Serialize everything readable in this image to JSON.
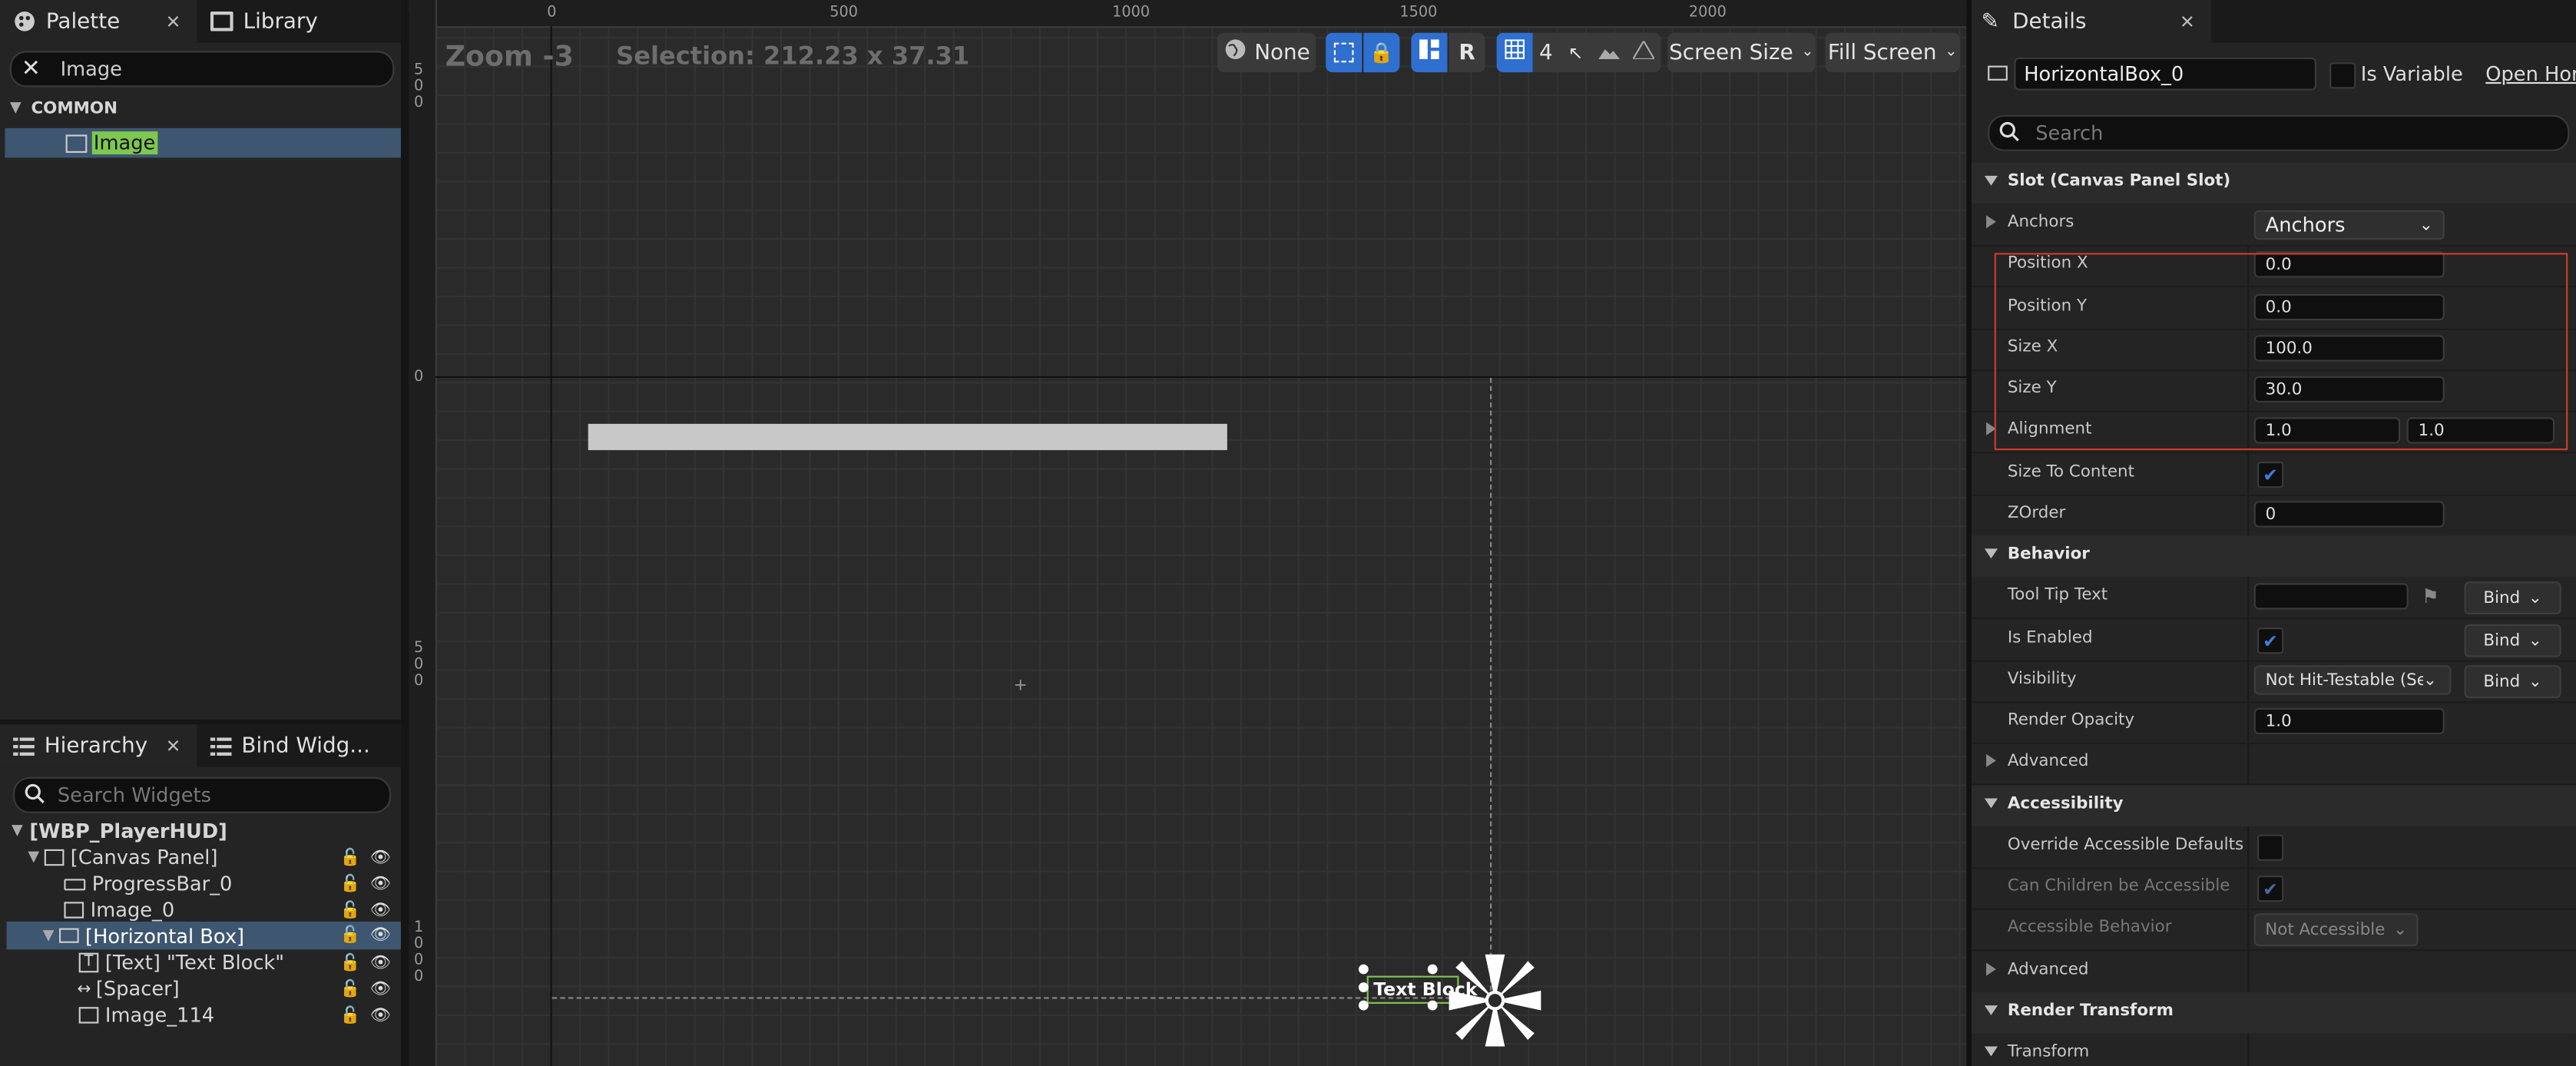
{
  "palette": {
    "tab_palette": "Palette",
    "tab_library": "Library",
    "search_value": "Image",
    "category": "COMMON",
    "item": "Image"
  },
  "hierarchy": {
    "tab_hierarchy": "Hierarchy",
    "tab_bind": "Bind Widg...",
    "search_placeholder": "Search Widgets",
    "items": [
      "[WBP_PlayerHUD]",
      "[Canvas Panel]",
      "ProgressBar_0",
      "Image_0",
      "[Horizontal Box]",
      "[Text] \"Text Block\"",
      "[Spacer]",
      "Image_114"
    ]
  },
  "viewport": {
    "zoom": "Zoom -3",
    "selection": "Selection: 212.23 x 37.31",
    "ruler_top": [
      "0",
      "500",
      "1000",
      "1500",
      "2000"
    ],
    "ruler_left": [
      "5\n0\n0",
      "0",
      "5\n0\n0",
      "1\n0\n0\n0"
    ],
    "none_label": "None",
    "r_label": "R",
    "grid_count": "4",
    "screen_size": "Screen Size",
    "fill_screen": "Fill Screen",
    "text_block": "Text Block"
  },
  "details": {
    "title": "Details",
    "widget_name": "HorizontalBox_0",
    "is_variable": "Is Variable",
    "open_link": "Open Hori",
    "search_placeholder": "Search",
    "slot_cat": "Slot (Canvas Panel Slot)",
    "anchors_label": "Anchors",
    "anchors_value": "Anchors",
    "pos_x_label": "Position X",
    "pos_x": "0.0",
    "pos_y_label": "Position Y",
    "pos_y": "0.0",
    "size_x_label": "Size X",
    "size_x": "100.0",
    "size_y_label": "Size Y",
    "size_y": "30.0",
    "alignment_label": "Alignment",
    "align_x": "1.0",
    "align_y": "1.0",
    "size_to_content": "Size To Content",
    "zorder_label": "ZOrder",
    "zorder": "0",
    "behavior_cat": "Behavior",
    "tooltip_label": "Tool Tip Text",
    "bind": "Bind",
    "enabled_label": "Is Enabled",
    "visibility_label": "Visibility",
    "visibility_value": "Not Hit-Testable (Se",
    "opacity_label": "Render Opacity",
    "opacity": "1.0",
    "advanced": "Advanced",
    "accessibility_cat": "Accessibility",
    "override_label": "Override Accessible Defaults",
    "children_label": "Can Children be Accessible",
    "acc_behavior_label": "Accessible Behavior",
    "acc_behavior_value": "Not Accessible",
    "advanced2": "Advanced",
    "render_transform_cat": "Render Transform",
    "transform_label": "Transform"
  },
  "colors": {
    "accent": "#2f6fd0",
    "highlight_box": "#d23a2a",
    "selection_green": "#7ec850"
  }
}
